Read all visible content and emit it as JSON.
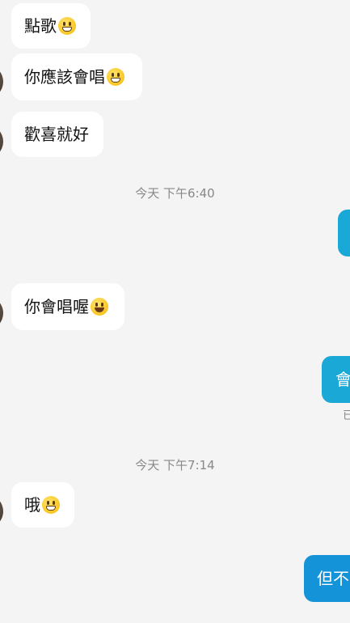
{
  "colors": {
    "background": "#f4f4f4",
    "incoming_bubble": "#ffffff",
    "outgoing_bubble_1": "#1aa8d6",
    "outgoing_bubble_2": "#1593d9",
    "timestamp_text": "#888888"
  },
  "messages": [
    {
      "side": "incoming",
      "text": "點歌",
      "emoji": "grinning-face-with-smiling-eyes-icon"
    },
    {
      "side": "incoming",
      "text": "你應該會唱",
      "emoji": "grinning-face-with-smiling-eyes-icon"
    },
    {
      "side": "incoming",
      "text": "歡喜就好"
    },
    {
      "type": "timestamp",
      "text": "今天 下午6:40"
    },
    {
      "side": "outgoing",
      "text": ""
    },
    {
      "side": "incoming",
      "text": "你會唱喔",
      "emoji": "grinning-face-icon"
    },
    {
      "side": "outgoing",
      "text": "會"
    },
    {
      "type": "read-status",
      "text": "已"
    },
    {
      "type": "timestamp",
      "text": "今天 下午7:14"
    },
    {
      "side": "incoming",
      "text": "哦",
      "emoji": "grinning-face-with-smiling-eyes-icon"
    },
    {
      "side": "outgoing",
      "text": "但不"
    }
  ]
}
